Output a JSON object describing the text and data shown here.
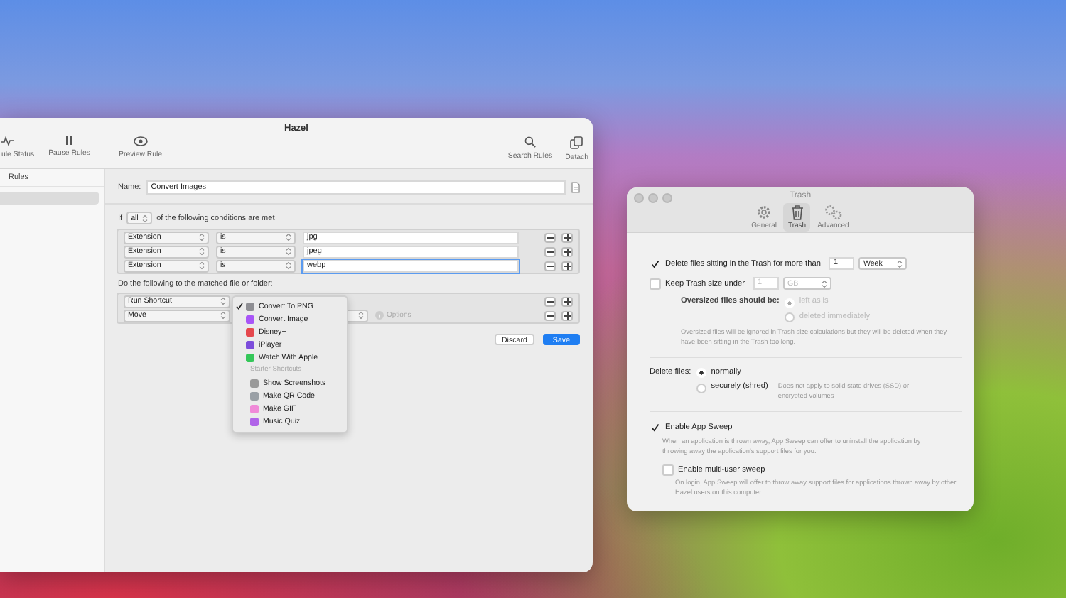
{
  "hazel": {
    "title": "Hazel",
    "toolbar_left": [
      {
        "kind": "status",
        "label": "ule Status"
      },
      {
        "kind": "pause",
        "label": "Pause Rules"
      },
      {
        "kind": "preview",
        "label": "Preview Rule"
      }
    ],
    "toolbar_right": [
      {
        "kind": "search",
        "label": "Search Rules"
      },
      {
        "kind": "detach",
        "label": "Detach"
      }
    ],
    "sidebar": {
      "header": "Rules",
      "rows": [
        {
          "selected": true
        }
      ]
    },
    "name_label": "Name:",
    "name_value": "Convert Images",
    "match_prefix": "If",
    "match_mode": "all",
    "match_suffix": "of the following conditions are met",
    "conditions": [
      {
        "attribute": "Extension",
        "operator": "is",
        "value": "jpg",
        "focused": false
      },
      {
        "attribute": "Extension",
        "operator": "is",
        "value": "jpeg",
        "focused": false
      },
      {
        "attribute": "Extension",
        "operator": "is",
        "value": "webp",
        "focused": true
      }
    ],
    "actions_header": "Do the following to the matched file or folder:",
    "actions": [
      {
        "action": "Run Shortcut"
      },
      {
        "action": "Move",
        "options": "Options"
      }
    ],
    "buttons": [
      {
        "label": "Discard",
        "kind": "secondary"
      },
      {
        "label": "Save",
        "kind": "primary"
      }
    ],
    "menu": [
      {
        "kind": "item",
        "label": "Convert To PNG",
        "checked": true,
        "color": "#8e8e93"
      },
      {
        "kind": "item",
        "label": "Convert Image",
        "checked": false,
        "color": "#a855f7"
      },
      {
        "kind": "item",
        "label": "Disney+",
        "checked": false,
        "color": "#e5484d"
      },
      {
        "kind": "item",
        "label": "iPlayer",
        "checked": false,
        "color": "#7c4ddb"
      },
      {
        "kind": "item",
        "label": "Watch With Apple",
        "checked": false,
        "color": "#34c759"
      },
      {
        "kind": "header",
        "label": "Starter Shortcuts"
      },
      {
        "kind": "item",
        "label": "Show Screenshots",
        "checked": false,
        "color": "#9a9a9a"
      },
      {
        "kind": "item",
        "label": "Make QR Code",
        "checked": false,
        "color": "#9aa0a6"
      },
      {
        "kind": "item",
        "label": "Make GIF",
        "checked": false,
        "color": "#f08ad8"
      },
      {
        "kind": "item",
        "label": "Music Quiz",
        "checked": false,
        "color": "#b064e8"
      }
    ]
  },
  "trash": {
    "title": "Trash",
    "tabs": [
      {
        "kind": "general",
        "label": "General",
        "selected": false
      },
      {
        "kind": "trash",
        "label": "Trash",
        "selected": true
      },
      {
        "kind": "advanced",
        "label": "Advanced",
        "selected": false
      }
    ],
    "delete_older": {
      "label": "Delete files sitting in the Trash for more than",
      "checked": true,
      "value": "1",
      "unit": "Week"
    },
    "keep_size": {
      "label": "Keep Trash size under",
      "checked": false,
      "placeholder": "1",
      "unit": "GB"
    },
    "oversized_label": "Oversized files should be:",
    "oversized_options": [
      {
        "label": "left as is",
        "selected": true
      },
      {
        "label": "deleted immediately",
        "selected": false
      }
    ],
    "oversized_note": "Oversized files will be ignored in Trash size calculations but they will be deleted when they have been sitting in the Trash too long.",
    "delete_label": "Delete files:",
    "delete_options": [
      {
        "label": "normally",
        "selected": true
      },
      {
        "label": "securely (shred)",
        "selected": false,
        "note": "Does not apply to solid state drives (SSD) or encrypted volumes"
      }
    ],
    "app_sweep": {
      "label": "Enable App Sweep",
      "checked": true,
      "note": "When an application is thrown away, App Sweep can offer to uninstall the application by throwing away the application's support files for you."
    },
    "multi_user": {
      "label": "Enable multi-user sweep",
      "checked": false,
      "note": "On login, App Sweep will offer to throw away support files for applications thrown away by other Hazel users on this computer."
    }
  }
}
